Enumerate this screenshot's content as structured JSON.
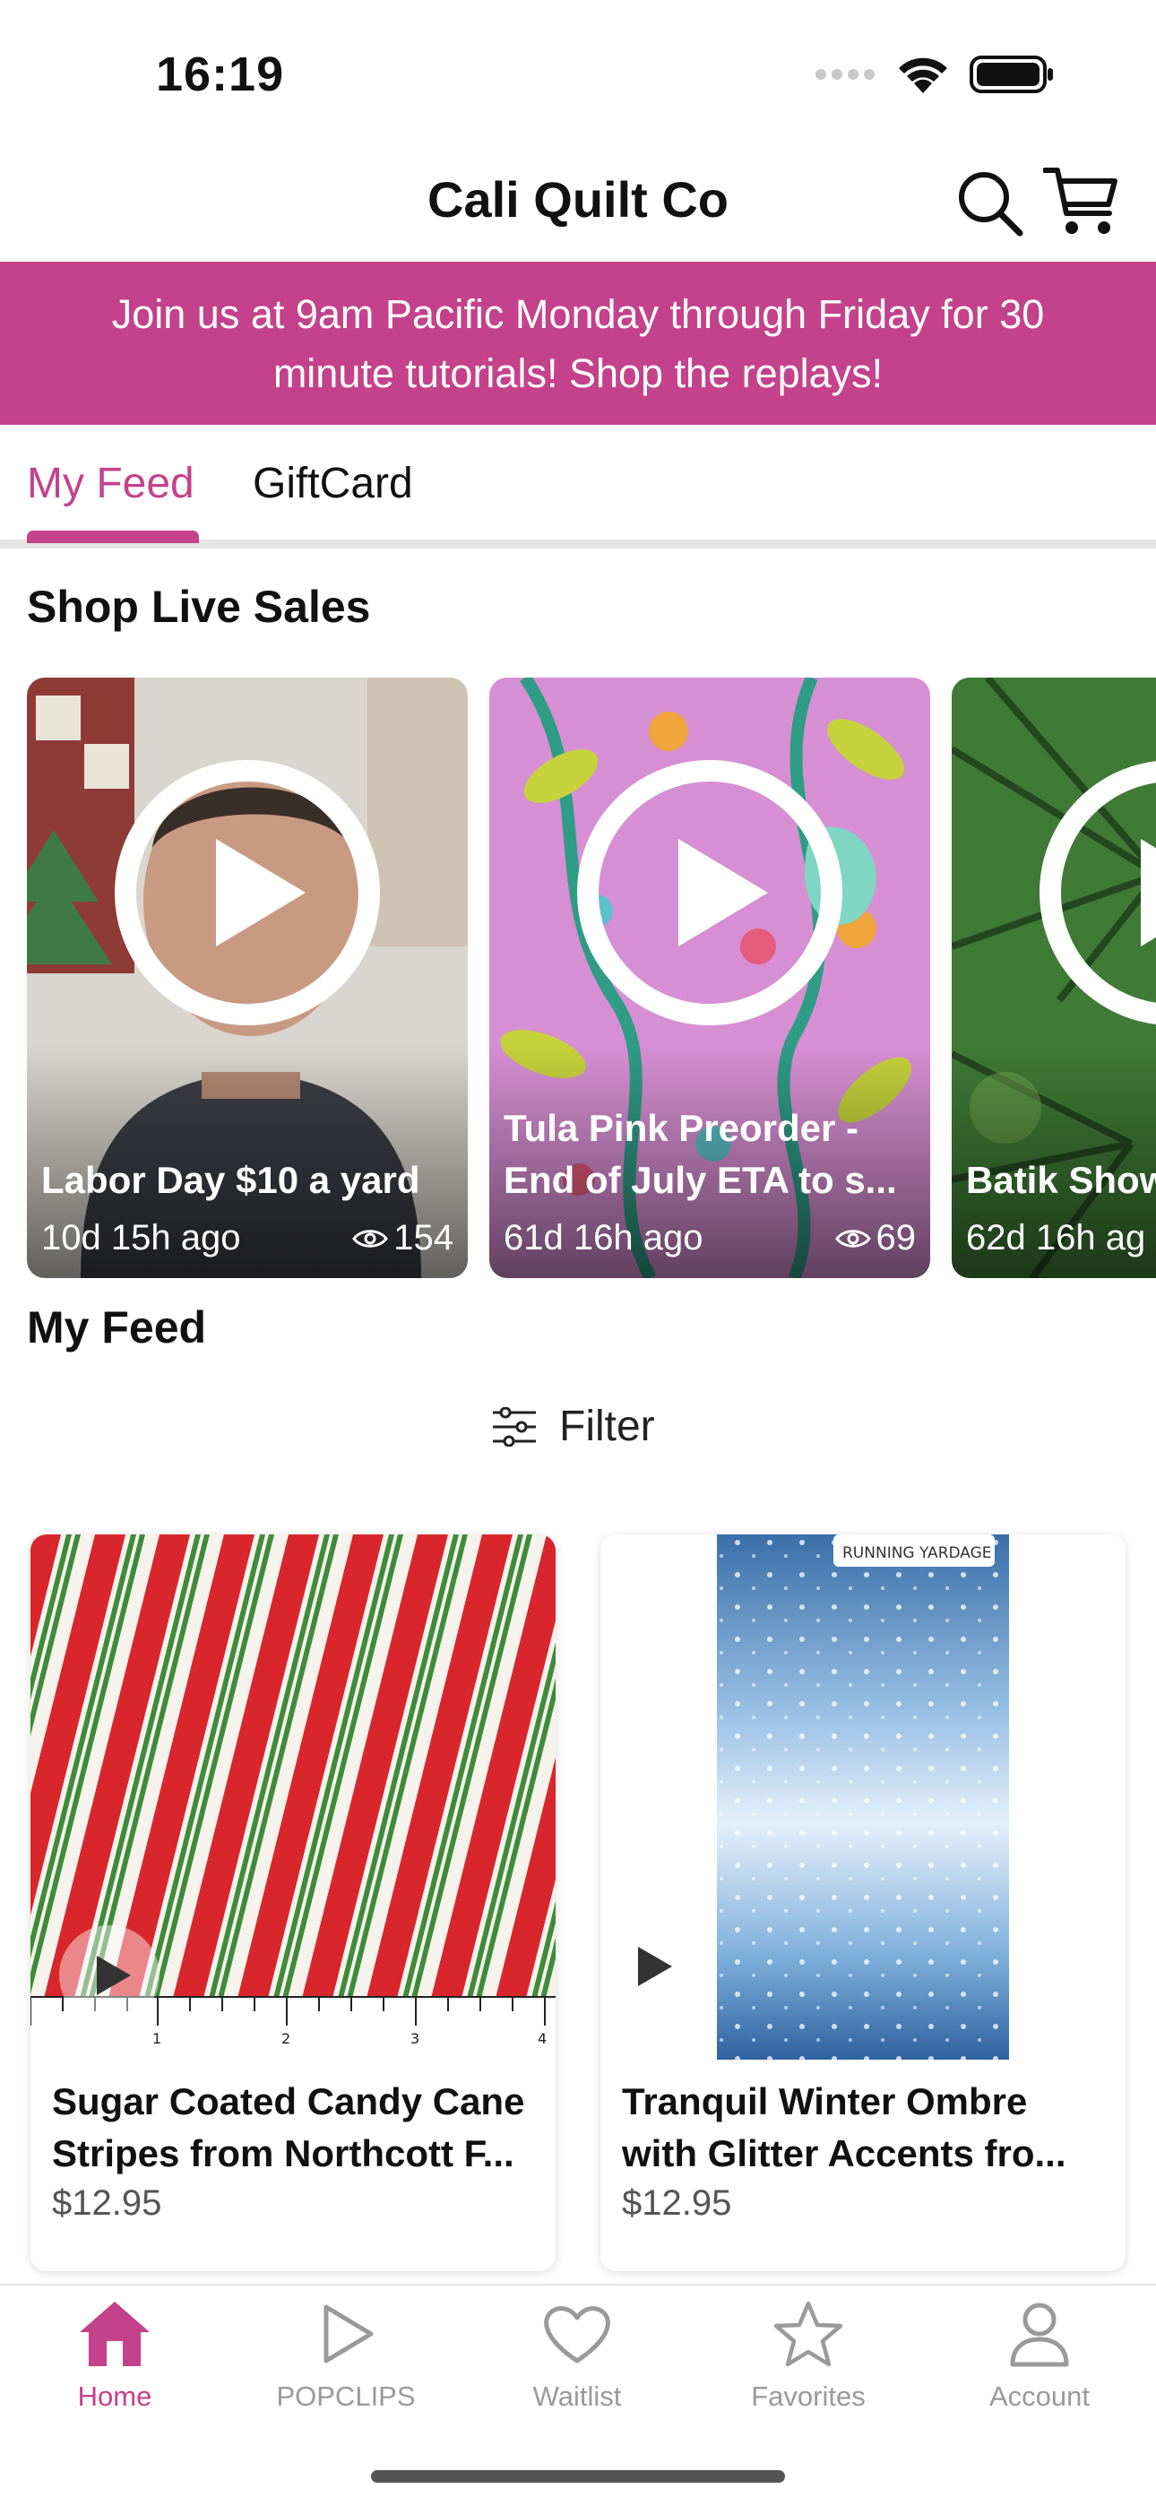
{
  "status_bar": {
    "time": "16:19"
  },
  "header": {
    "title": "Cali Quilt Co",
    "search_icon": "search-icon",
    "cart_icon": "cart-icon"
  },
  "banner": {
    "text": "Join us at 9am Pacific Monday through Friday for 30 minute tutorials!  Shop the replays!"
  },
  "tabs": [
    {
      "label": "My Feed",
      "active": true
    },
    {
      "label": "GiftCard",
      "active": false
    }
  ],
  "live_section": {
    "title": "Shop Live Sales",
    "items": [
      {
        "title": "Labor Day $10 a yard",
        "age": "10d 15h ago",
        "views": "154"
      },
      {
        "title": "Tula Pink Preorder - End of July ETA to s...",
        "title_line1": "Tula Pink Preorder -",
        "title_line2": "End of July ETA to s...",
        "age": "61d 16h ago",
        "views": "69"
      },
      {
        "title": "Batik Show",
        "age": "62d 16h ag",
        "views": ""
      }
    ]
  },
  "feed": {
    "title": "My Feed",
    "filter_label": "Filter",
    "products": [
      {
        "name_line1": "Sugar Coated Candy Cane",
        "name_line2": "Stripes from Northcott F...",
        "price": "$12.95"
      },
      {
        "name_line1": "Tranquil Winter Ombre",
        "name_line2": "with Glitter Accents fro...",
        "price": "$12.95",
        "image_label": "RUNNING YARDAGE"
      }
    ]
  },
  "bottom_nav": [
    {
      "label": "Home",
      "icon": "home-icon",
      "active": true
    },
    {
      "label": "POPCLIPS",
      "icon": "play-outline-icon",
      "active": false
    },
    {
      "label": "Waitlist",
      "icon": "heart-icon",
      "active": false
    },
    {
      "label": "Favorites",
      "icon": "star-icon",
      "active": false
    },
    {
      "label": "Account",
      "icon": "person-icon",
      "active": false
    }
  ],
  "colors": {
    "brand": "#c4428b",
    "inactive": "#9a9a9a"
  }
}
